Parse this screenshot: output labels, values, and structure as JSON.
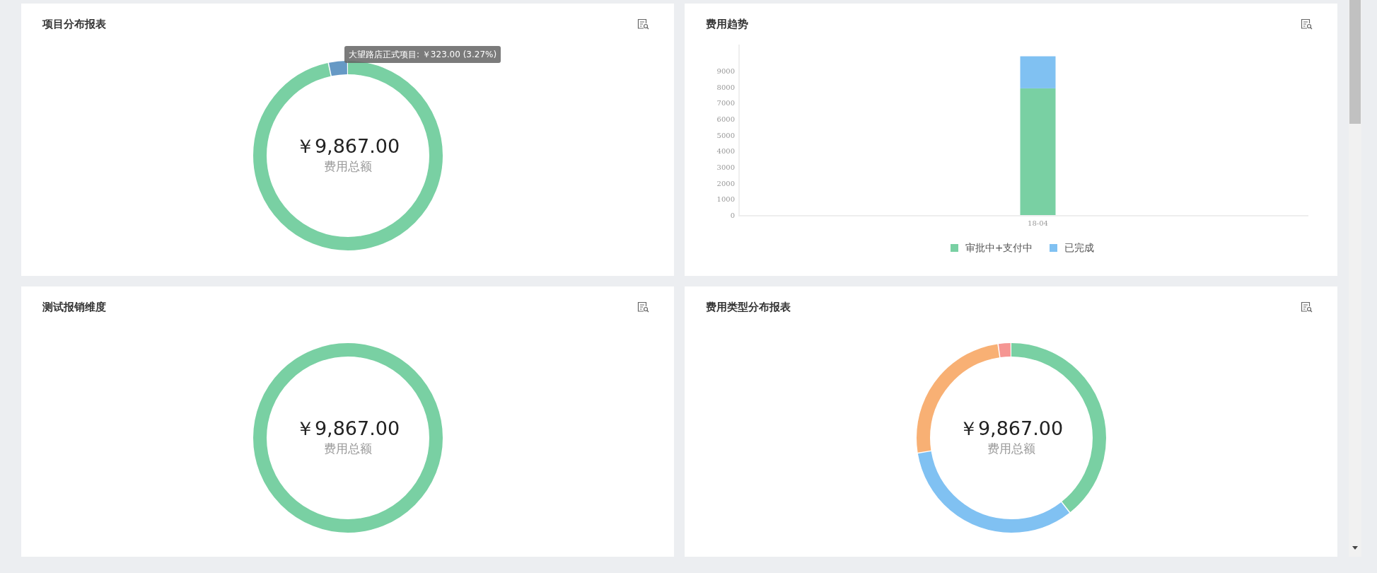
{
  "cards": [
    {
      "kind": "donut",
      "title": "项目分布报表",
      "total": "￥9,867.00",
      "total_label": "费用总额",
      "tooltip": "大望路店正式项目: ￥323.00 (3.27%)"
    },
    {
      "kind": "bar",
      "title": "费用趋势",
      "chart_data": {
        "type": "bar",
        "stacked": true,
        "categories": [
          "18-04"
        ],
        "ylim": [
          0,
          10000
        ],
        "yticks": [
          0,
          1000,
          2000,
          3000,
          4000,
          5000,
          6000,
          7000,
          8000,
          9000
        ],
        "series": [
          {
            "name": "审批中+支付中",
            "color": "#79d0a3",
            "values": [
              7900
            ]
          },
          {
            "name": "已完成",
            "color": "#80c1f2",
            "values": [
              2000
            ]
          }
        ]
      }
    },
    {
      "kind": "donut",
      "title": "测试报销维度",
      "total": "￥9,867.00",
      "total_label": "费用总额"
    },
    {
      "kind": "donut",
      "title": "费用类型分布报表",
      "total": "￥9,867.00",
      "total_label": "费用总额"
    }
  ]
}
